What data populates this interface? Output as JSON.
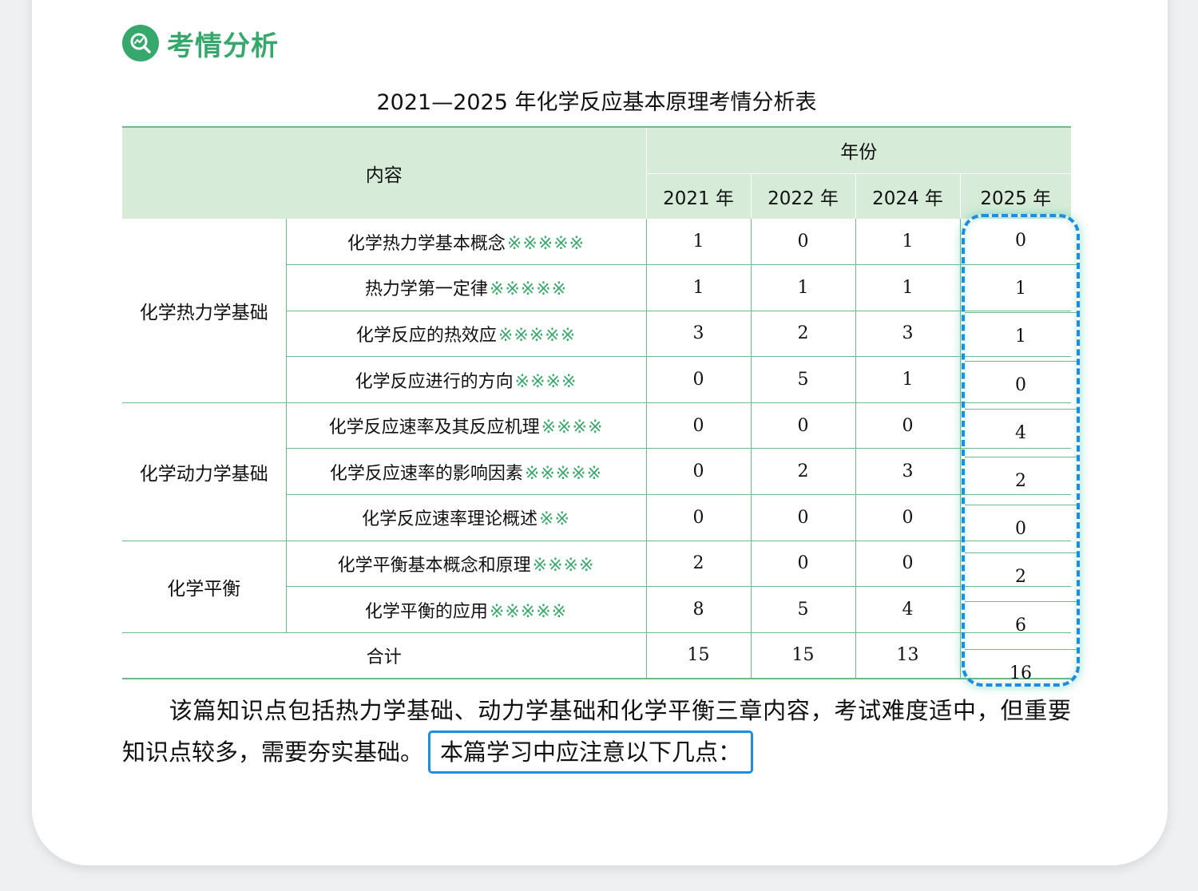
{
  "section": {
    "icon": "magnifier-chart-icon",
    "title": "考情分析"
  },
  "table_title": "2021—2025 年化学反应基本原理考情分析表",
  "table": {
    "content_header": "内容",
    "year_header": "年份",
    "years": [
      "2021 年",
      "2022 年",
      "2024 年",
      "2025 年"
    ],
    "groups": [
      {
        "name": "化学热力学基础",
        "rows": [
          {
            "topic": "化学热力学基本概念",
            "stars": "※※※※※",
            "values": [
              "1",
              "0",
              "1",
              "0"
            ]
          },
          {
            "topic": "热力学第一定律",
            "stars": "※※※※※",
            "values": [
              "1",
              "1",
              "1",
              "1"
            ]
          },
          {
            "topic": "化学反应的热效应",
            "stars": "※※※※※",
            "values": [
              "3",
              "2",
              "3",
              "1"
            ]
          },
          {
            "topic": "化学反应进行的方向",
            "stars": "※※※※",
            "values": [
              "0",
              "5",
              "1",
              "0"
            ]
          }
        ]
      },
      {
        "name": "化学动力学基础",
        "rows": [
          {
            "topic": "化学反应速率及其反应机理",
            "stars": "※※※※",
            "values": [
              "0",
              "0",
              "0",
              "4"
            ]
          },
          {
            "topic": "化学反应速率的影响因素",
            "stars": "※※※※※",
            "values": [
              "0",
              "2",
              "3",
              "2"
            ]
          },
          {
            "topic": "化学反应速率理论概述",
            "stars": "※※",
            "values": [
              "0",
              "0",
              "0",
              "0"
            ]
          }
        ]
      },
      {
        "name": "化学平衡",
        "rows": [
          {
            "topic": "化学平衡基本概念和原理",
            "stars": "※※※※",
            "values": [
              "2",
              "0",
              "0",
              "2"
            ]
          },
          {
            "topic": "化学平衡的应用",
            "stars": "※※※※※",
            "values": [
              "8",
              "5",
              "4",
              "6"
            ]
          }
        ]
      }
    ],
    "total_label": "合计",
    "totals": [
      "15",
      "15",
      "13",
      "16"
    ]
  },
  "paragraph": {
    "text": "该篇知识点包括热力学基础、动力学基础和化学平衡三章内容，考试难度适中，但重要知识点较多，需要夯实基础。",
    "highlight": "本篇学习中应注意以下几点："
  },
  "colors": {
    "accent_green": "#36a86c",
    "header_bg": "#d6ecd8",
    "highlight_blue": "#1e8de0"
  }
}
